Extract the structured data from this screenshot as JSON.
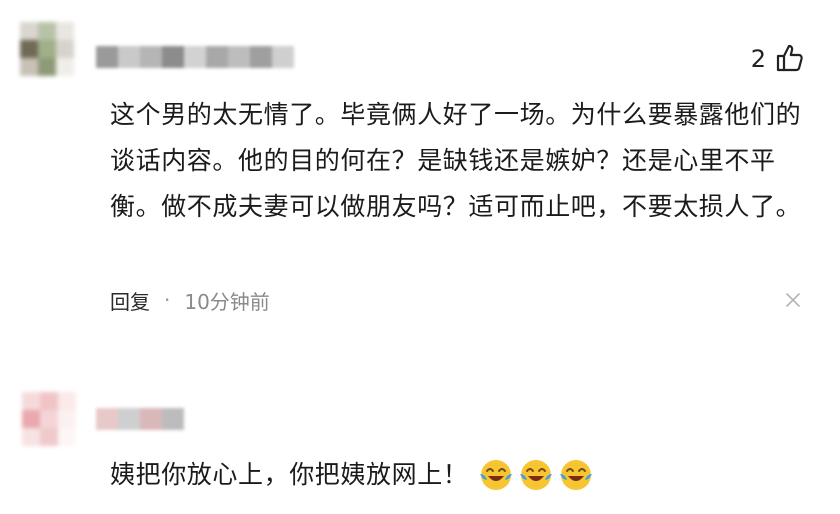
{
  "comments": [
    {
      "like_count": "2",
      "text": "这个男的太无情了。毕竟俩人好了一场。为什么要暴露他们的谈话内容。他的目的何在？是缺钱还是嫉妒？还是心里不平衡。做不成夫妻可以做朋友吗？适可而止吧，不要太损人了。",
      "reply_label": "回复",
      "separator": "·",
      "timestamp": "10分钟前"
    },
    {
      "text": "姨把你放心上，你把姨放网上！",
      "emojis": [
        "laughing-tears-emoji",
        "laughing-tears-emoji",
        "laughing-tears-emoji"
      ]
    }
  ],
  "icons": {
    "like": "thumbs-up-icon",
    "close": "close-icon"
  },
  "colors": {
    "text": "#1b1b1b",
    "muted": "#8a8a8a",
    "emoji_face": "#f7c531",
    "emoji_tear": "#3aa0e6"
  }
}
